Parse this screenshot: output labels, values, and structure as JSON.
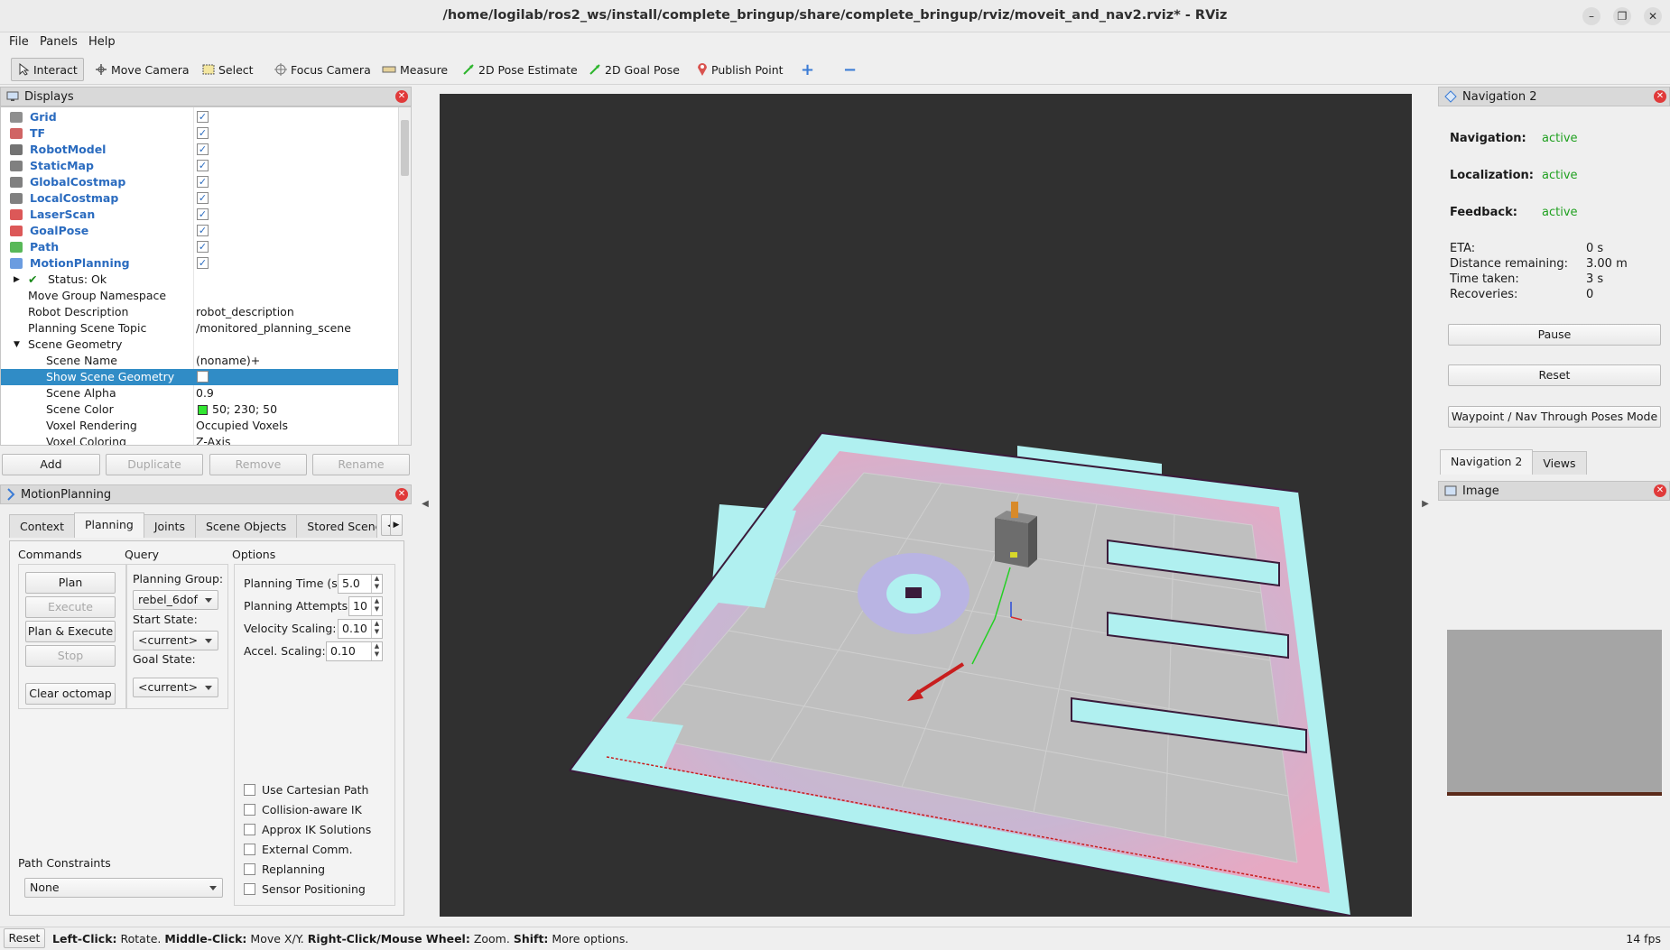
{
  "window": {
    "title": "/home/logilab/ros2_ws/install/complete_bringup/share/complete_bringup/rviz/moveit_and_nav2.rviz* - RViz",
    "controls": [
      "–",
      "❐",
      "✕"
    ]
  },
  "menu": {
    "file": "File",
    "panels": "Panels",
    "help": "Help"
  },
  "toolbar": {
    "interact": "Interact",
    "move_camera": "Move Camera",
    "select": "Select",
    "focus_camera": "Focus Camera",
    "measure": "Measure",
    "pose_estimate": "2D Pose Estimate",
    "goal_pose": "2D Goal Pose",
    "publish_point": "Publish Point",
    "plus": "+",
    "minus": "−"
  },
  "displays": {
    "title": "Displays",
    "items": [
      {
        "name": "Grid",
        "icon": "grid-icon",
        "checked": true
      },
      {
        "name": "TF",
        "icon": "tf-icon",
        "checked": true
      },
      {
        "name": "RobotModel",
        "icon": "robot-model-icon",
        "checked": true
      },
      {
        "name": "StaticMap",
        "icon": "map-icon",
        "checked": true
      },
      {
        "name": "GlobalCostmap",
        "icon": "map-icon",
        "checked": true
      },
      {
        "name": "LocalCostmap",
        "icon": "map-icon",
        "checked": true
      },
      {
        "name": "LaserScan",
        "icon": "laser-scan-icon",
        "checked": true
      },
      {
        "name": "GoalPose",
        "icon": "pose-icon",
        "checked": true
      },
      {
        "name": "Path",
        "icon": "path-icon",
        "checked": true
      },
      {
        "name": "MotionPlanning",
        "icon": "motion-planning-icon",
        "checked": true
      }
    ],
    "props": [
      {
        "name": "Status: Ok",
        "value": ""
      },
      {
        "name": "Move Group Namespace",
        "value": ""
      },
      {
        "name": "Robot Description",
        "value": "robot_description"
      },
      {
        "name": "Planning Scene Topic",
        "value": "/monitored_planning_scene"
      },
      {
        "name": "Scene Geometry",
        "value": ""
      },
      {
        "name": "Scene Name",
        "value": "(noname)+"
      },
      {
        "name": "Show Scene Geometry",
        "value": ""
      },
      {
        "name": "Scene Alpha",
        "value": "0.9"
      },
      {
        "name": "Scene Color",
        "value": "50; 230; 50"
      },
      {
        "name": "Voxel Rendering",
        "value": "Occupied Voxels"
      },
      {
        "name": "Voxel Coloring",
        "value": "Z-Axis"
      }
    ],
    "buttons": {
      "add": "Add",
      "duplicate": "Duplicate",
      "remove": "Remove",
      "rename": "Rename"
    }
  },
  "motion": {
    "title": "MotionPlanning",
    "tabs": [
      "Context",
      "Planning",
      "Joints",
      "Scene Objects",
      "Stored Scenes"
    ],
    "active_tab": "Planning",
    "commands": {
      "heading": "Commands",
      "plan": "Plan",
      "execute": "Execute",
      "plan_execute": "Plan & Execute",
      "stop": "Stop",
      "clear_octomap": "Clear octomap"
    },
    "query": {
      "heading": "Query",
      "planning_group_label": "Planning Group:",
      "planning_group": "rebel_6dof",
      "start_state_label": "Start State:",
      "start_state": "<current>",
      "goal_state_label": "Goal State:",
      "goal_state": "<current>"
    },
    "options": {
      "heading": "Options",
      "planning_time_label": "Planning Time (s):",
      "planning_time": "5.0",
      "planning_attempts_label": "Planning Attempts:",
      "planning_attempts": "10",
      "velocity_label": "Velocity Scaling:",
      "velocity": "0.10",
      "accel_label": "Accel. Scaling:",
      "accel": "0.10",
      "checkboxes": [
        "Use Cartesian Path",
        "Collision-aware IK",
        "Approx IK Solutions",
        "External Comm.",
        "Replanning",
        "Sensor Positioning"
      ]
    },
    "path_constraints": {
      "label": "Path Constraints",
      "value": "None"
    }
  },
  "nav2": {
    "title": "Navigation 2",
    "navigation_label": "Navigation:",
    "navigation": "active",
    "localization_label": "Localization:",
    "localization": "active",
    "feedback_label": "Feedback:",
    "feedback": "active",
    "eta_label": "ETA:",
    "eta": "0 s",
    "distance_label": "Distance remaining:",
    "distance": "3.00 m",
    "time_label": "Time taken:",
    "time": "3 s",
    "recoveries_label": "Recoveries:",
    "recoveries": "0",
    "pause": "Pause",
    "reset": "Reset",
    "mode": "Waypoint / Nav Through Poses Mode",
    "tabs": [
      "Navigation 2",
      "Views"
    ]
  },
  "image_panel": {
    "title": "Image"
  },
  "status": {
    "reset": "Reset",
    "hint_left_click": "Left-Click:",
    "hint_left": "Rotate.",
    "hint_middle_click": "Middle-Click:",
    "hint_middle": "Move X/Y.",
    "hint_right_click": "Right-Click/Mouse Wheel:",
    "hint_right": "Zoom.",
    "hint_shift": "Shift:",
    "hint_shift_text": "More options.",
    "fps": "14 fps"
  },
  "colors": {
    "accent": "#308cc6",
    "display_name": "#2a6bbf",
    "active": "#20a020",
    "scene_color": "#32e632",
    "close": "#e03a3a"
  }
}
